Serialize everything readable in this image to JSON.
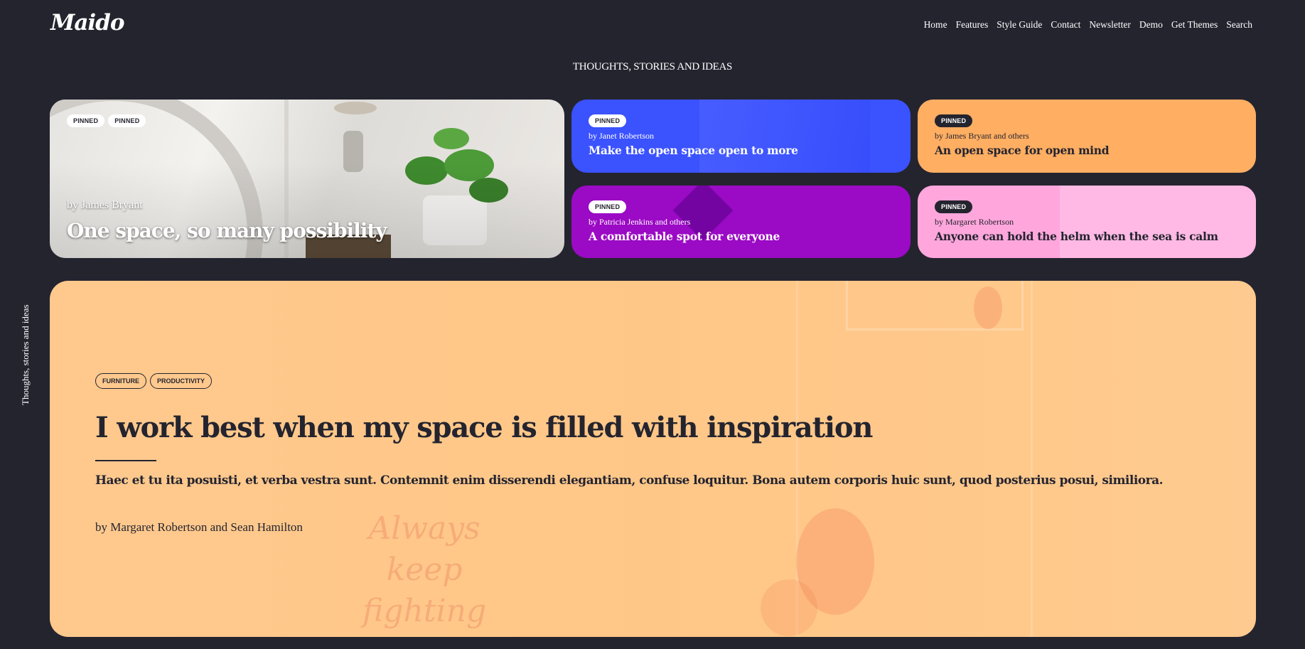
{
  "header": {
    "logo": "Maido",
    "nav": [
      "Home",
      "Features",
      "Style Guide",
      "Contact",
      "Newsletter",
      "Demo",
      "Get Themes",
      "Search"
    ]
  },
  "tagline": "THOUGHTS, STORIES AND IDEAS",
  "side_text": "Thoughts, stories and ideas",
  "cards": {
    "hero": {
      "badges": [
        "PINNED",
        "PINNED"
      ],
      "author": "by James Bryant",
      "title": "One space, so many possibility"
    },
    "blue": {
      "badge": "PINNED",
      "author": "by Janet Robertson",
      "title": "Make the open space open to more",
      "color": "#3b52ff"
    },
    "orange": {
      "badge": "PINNED",
      "author": "by James Bryant and others",
      "title": "An open space for open mind",
      "color": "#ffae62"
    },
    "purple": {
      "badge": "PINNED",
      "author": "by Patricia Jenkins and others",
      "title": "A comfortable spot for everyone",
      "color": "#9b0ac4"
    },
    "pink": {
      "badge": "PINNED",
      "author": "by Margaret Robertson",
      "title": "Anyone can hold the helm when the sea is calm",
      "color": "#ffa7dc"
    }
  },
  "feature": {
    "tags": [
      "FURNITURE",
      "PRODUCTIVITY"
    ],
    "heading": "I work best when my space is filled with inspiration",
    "excerpt": "Haec et tu ita posuisti, et verba vestra sunt. Contemnit enim disserendi elegantiam, confuse loquitur. Bona autem corporis huic sunt, quod posterius posui, similiora.",
    "author": "by Margaret Robertson and Sean Hamilton",
    "background_text": [
      "Always",
      "keep",
      "fighting"
    ]
  }
}
